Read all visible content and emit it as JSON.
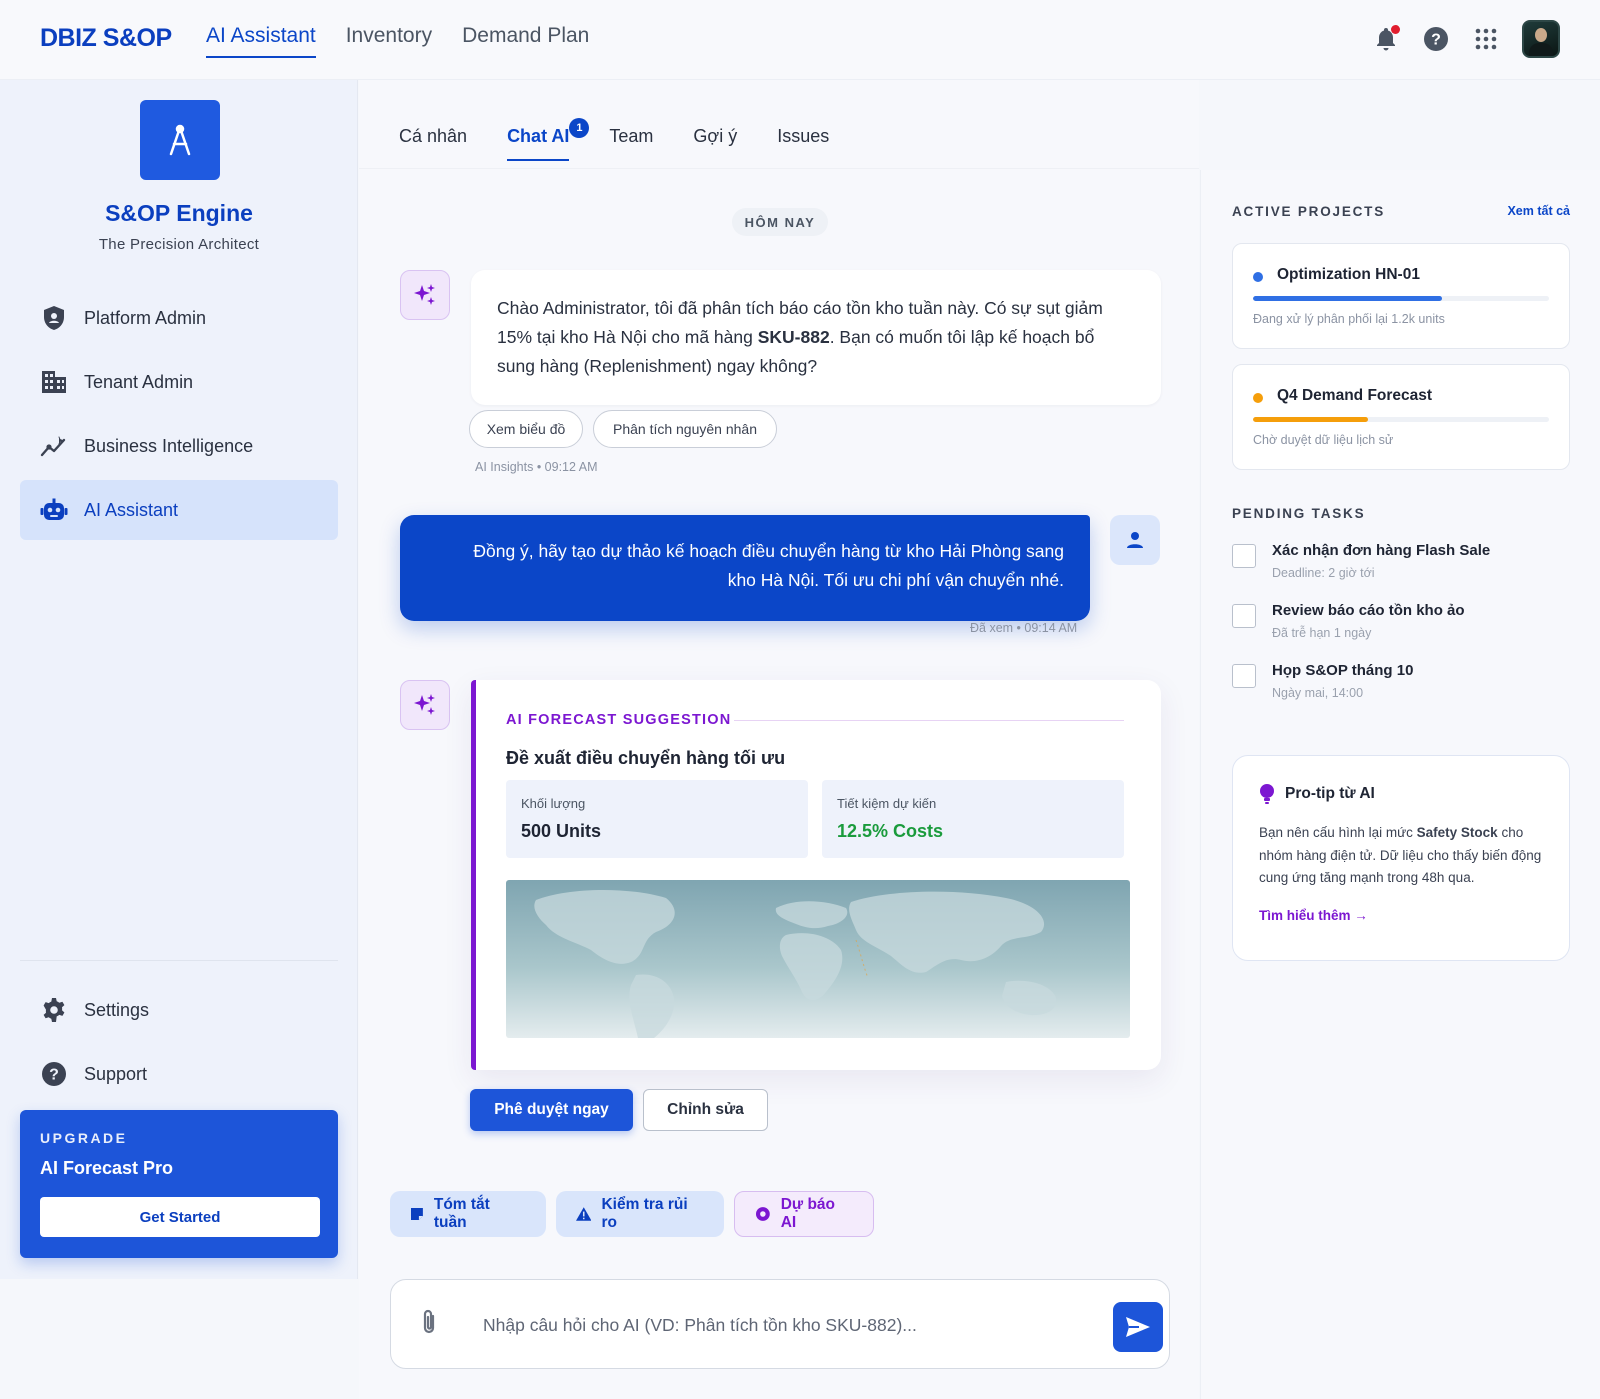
{
  "brand": "DBIZ S&OP",
  "topnav": [
    "AI Assistant",
    "Inventory",
    "Demand Plan"
  ],
  "top_icons": [
    "bell-icon",
    "help-icon",
    "apps-grid-icon",
    "avatar"
  ],
  "colors": {
    "primary": "#0b46c8",
    "accent_purple": "#7c17d1",
    "success": "#1a9b3c",
    "warning": "#f59e0b"
  },
  "sidebar": {
    "title": "S&OP Engine",
    "subtitle": "The Precision Architect",
    "items": [
      {
        "label": "Platform Admin",
        "icon": "shield-icon"
      },
      {
        "label": "Tenant Admin",
        "icon": "building-icon"
      },
      {
        "label": "Business Intelligence",
        "icon": "insights-icon"
      },
      {
        "label": "AI Assistant",
        "icon": "robot-icon"
      }
    ],
    "bottom_items": [
      {
        "label": "Settings",
        "icon": "gear-icon"
      },
      {
        "label": "Support",
        "icon": "help-icon"
      }
    ],
    "upgrade": {
      "eyebrow": "UPGRADE",
      "title": "AI Forecast Pro",
      "button": "Get Started"
    }
  },
  "tabs": [
    {
      "label": "Cá nhân"
    },
    {
      "label": "Chat AI",
      "badge": "1"
    },
    {
      "label": "Team"
    },
    {
      "label": "Gợi ý"
    },
    {
      "label": "Issues"
    }
  ],
  "chat": {
    "day_label": "HÔM NAY",
    "ai_message": {
      "before": "Chào Administrator, tôi đã phân tích báo cáo tồn kho tuần này. Có sự sụt giảm 15% tại kho Hà Nội cho mã hàng ",
      "bold": "SKU-882",
      "after": ". Bạn có muốn tôi lập kế hoạch bổ sung hàng (Replenishment) ngay không?",
      "chips": [
        "Xem biểu đồ",
        "Phân tích nguyên nhân"
      ],
      "meta": "AI Insights • 09:12 AM"
    },
    "user_message": {
      "line1": "Đồng ý, hãy tạo dự thảo kế hoạch điều chuyển hàng từ kho Hải Phòng sang",
      "line2": "kho Hà Nội. Tối ưu chi phí vận chuyển nhé.",
      "meta": "Đã xem • 09:14 AM"
    },
    "suggestion": {
      "eyebrow": "AI FORECAST SUGGESTION",
      "title": "Đề xuất điều chuyển hàng tối ưu",
      "stats": [
        {
          "label": "Khối lượng",
          "value": "500 Units"
        },
        {
          "label": "Tiết kiệm dự kiến",
          "value": "12.5% Costs"
        }
      ],
      "approve": "Phê duyệt ngay",
      "edit": "Chỉnh sửa"
    },
    "quick_actions": [
      "Tóm tắt tuần",
      "Kiểm tra rủi ro",
      "Dự báo AI"
    ],
    "input_placeholder": "Nhập câu hỏi cho AI (VD: Phân tích tồn kho SKU-882)..."
  },
  "right_panel": {
    "active_projects_title": "ACTIVE PROJECTS",
    "see_all": "Xem tất cả",
    "projects": [
      {
        "name": "Optimization HN-01",
        "desc": "Đang xử lý phân phối lại 1.2k units",
        "progress": 0.64,
        "color": "#2f6fe4"
      },
      {
        "name": "Q4 Demand Forecast",
        "desc": "Chờ duyệt dữ liệu lịch sử",
        "progress": 0.39,
        "color": "#f59e0b"
      }
    ],
    "pending_tasks_title": "PENDING TASKS",
    "tasks": [
      {
        "name": "Xác nhận đơn hàng Flash Sale",
        "detail": "Deadline: 2 giờ tới"
      },
      {
        "name": "Review báo cáo tồn kho ảo",
        "detail": "Đã trễ hạn 1 ngày"
      },
      {
        "name": "Họp S&OP tháng 10",
        "detail": "Ngày mai, 14:00"
      }
    ],
    "protip": {
      "title": "Pro-tip từ AI",
      "before": "Bạn nên cấu hình lại mức ",
      "bold": "Safety Stock",
      "after": " cho nhóm hàng điện tử. Dữ liệu cho thấy biến động cung ứng tăng mạnh trong 48h qua.",
      "link": "Tìm hiểu thêm →"
    }
  }
}
